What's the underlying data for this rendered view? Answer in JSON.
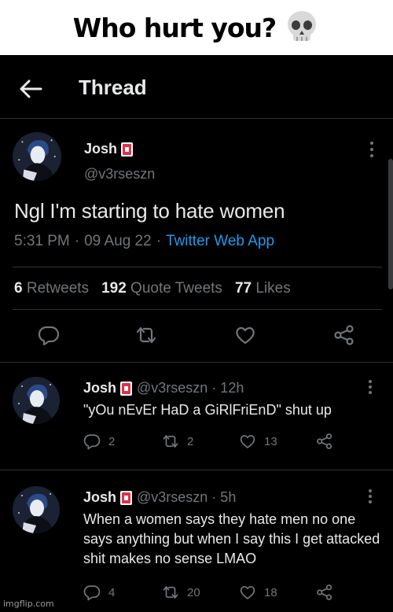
{
  "meme": {
    "caption": "Who hurt you?",
    "emoji": "skull-emoji"
  },
  "topbar": {
    "title": "Thread"
  },
  "main_tweet": {
    "display_name": "Josh",
    "badge": "red-card-emoji",
    "handle": "@v3rseszn",
    "text": "Ngl I'm starting to hate women",
    "time": "5:31 PM",
    "dot1": "·",
    "date": "09 Aug 22",
    "dot2": "·",
    "source": "Twitter Web App",
    "retweets_count": "6",
    "retweets_label": "Retweets",
    "quotes_count": "192",
    "quotes_label": "Quote Tweets",
    "likes_count": "77",
    "likes_label": "Likes"
  },
  "replies": [
    {
      "display_name": "Josh",
      "handle_time": "@v3rseszn · 12h",
      "text": "\"yOu nEvEr HaD a GiRlFriEnD\" shut up",
      "replies": "2",
      "retweets": "2",
      "likes": "13"
    },
    {
      "display_name": "Josh",
      "handle_time": "@v3rseszn · 5h",
      "text": "When a women says they hate men no one says anything but when I say this I get attacked shit makes no sense LMAO",
      "replies": "4",
      "retweets": "20",
      "likes": "18"
    }
  ],
  "watermark": "imgflip.com",
  "colors": {
    "background": "#000000",
    "text": "#e7e9ea",
    "muted": "#71767b",
    "link": "#1d9bf0",
    "divider": "#2f3336"
  }
}
